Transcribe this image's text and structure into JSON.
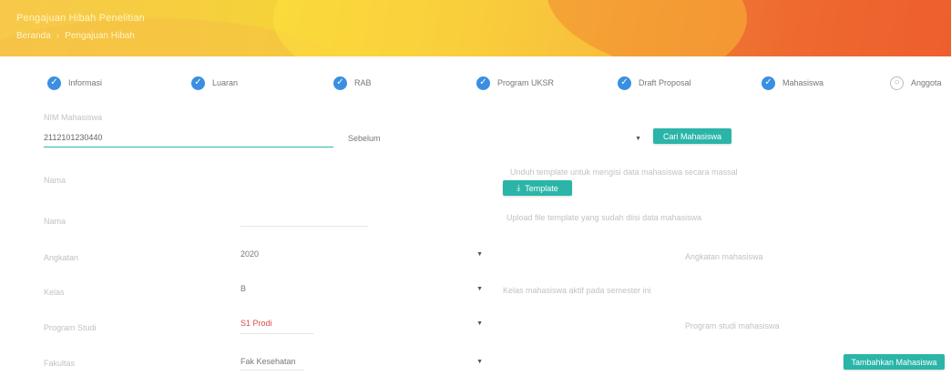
{
  "header": {
    "title": "Pengajuan Hibah Penelitian",
    "crumbs": [
      "Beranda",
      "Pengajuan Hibah"
    ]
  },
  "steps": [
    {
      "label": "Informasi",
      "done": true
    },
    {
      "label": "Luaran",
      "done": true
    },
    {
      "label": "RAB",
      "done": true
    },
    {
      "label": "Program UKSR",
      "done": true
    },
    {
      "label": "Draft Proposal",
      "done": true
    },
    {
      "label": "Mahasiswa",
      "done": true
    },
    {
      "label": "Anggota",
      "done": false
    }
  ],
  "form": {
    "nim_label": "NIM Mahasiswa",
    "nim_value": "2112101230440",
    "select_default": "Sebelum",
    "cari_label": "Cari Mahasiswa",
    "template_note": "Unduh template untuk mengisi data mahasiswa secara massal",
    "template_label": "Template",
    "upload_note": "Upload file template yang sudah diisi data mahasiswa",
    "row_labels": [
      "Nama",
      "Angkatan",
      "Kelas",
      "Program Studi",
      "Fakultas"
    ],
    "nama_value": "",
    "angkatan_value": "2020",
    "kelas_value": "B",
    "prodi_value": "S1 Prodi",
    "fakultas_value": "Fak Kesehatan",
    "side_note_1": "Angkatan mahasiswa",
    "side_note_2": "Kelas mahasiswa aktif pada semester ini",
    "side_note_3": "Program studi mahasiswa",
    "tambah_label": "Tambahkan Mahasiswa"
  },
  "icons": {
    "check": "✓",
    "download": "⤓",
    "caret": "▼",
    "pending": "○"
  },
  "colors": {
    "accent": "#2bb5a8",
    "step_done": "#3a8fe0",
    "input_focus": "#29b6b6"
  }
}
